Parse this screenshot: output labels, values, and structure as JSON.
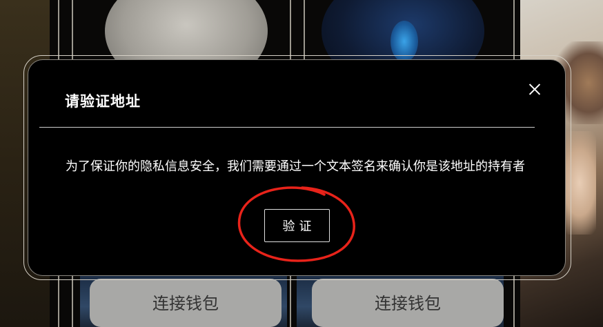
{
  "background": {
    "connect_buttons": [
      "连接钱包",
      "连接钱包"
    ]
  },
  "modal": {
    "title": "请验证地址",
    "message": "为了保证你的隐私信息安全，我们需要通过一个文本签名来确认你是该地址的持有者",
    "verify_label": "验证",
    "close_icon": "close-icon"
  },
  "annotation": {
    "color": "#e8231a"
  }
}
